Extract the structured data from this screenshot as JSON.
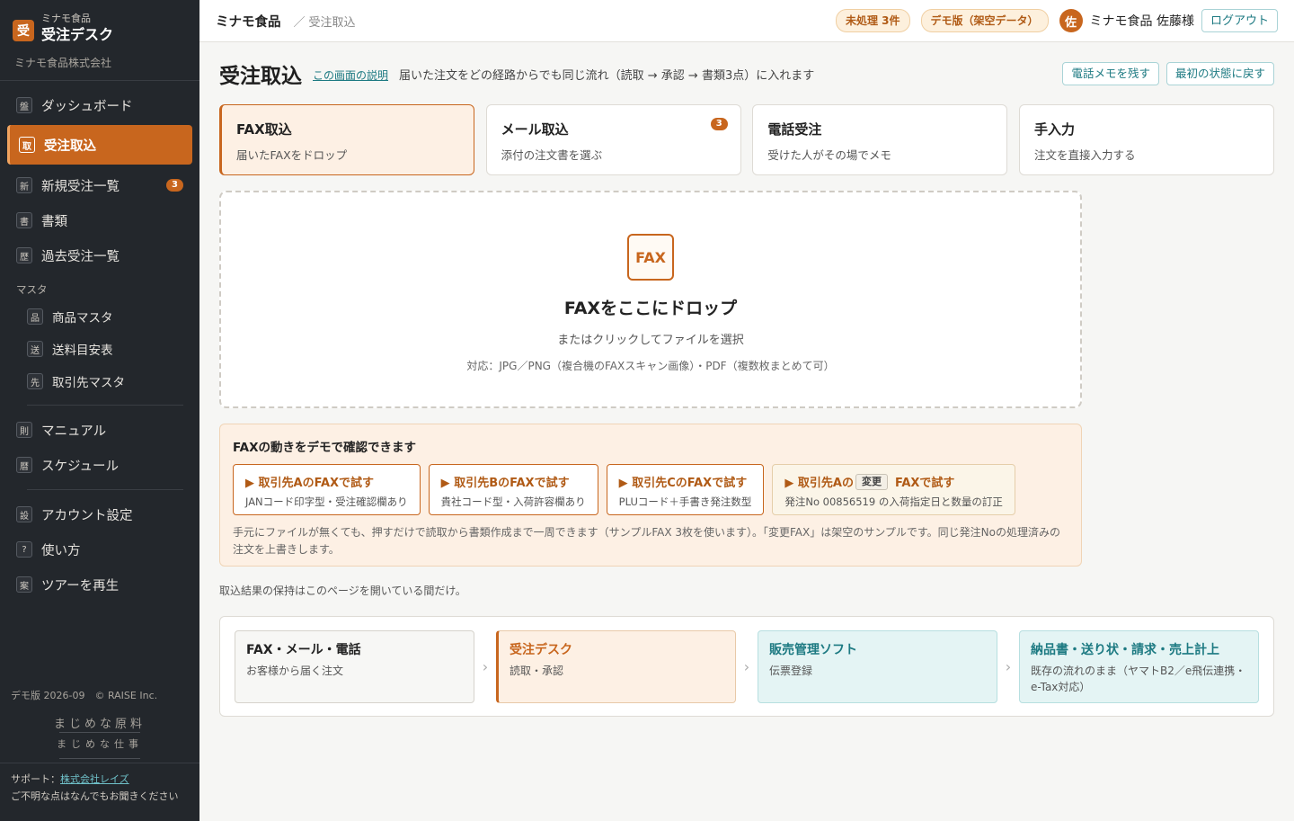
{
  "sidebar": {
    "logo_char": "受",
    "brand_small": "ミナモ食品",
    "brand_name": "受注デスク",
    "company": "ミナモ食品株式会社",
    "items": [
      {
        "icon": "盤",
        "label": "ダッシュボード"
      },
      {
        "icon": "取",
        "label": "受注取込"
      },
      {
        "icon": "新",
        "label": "新規受注一覧",
        "badge": "3"
      },
      {
        "icon": "書",
        "label": "書類"
      },
      {
        "icon": "歴",
        "label": "過去受注一覧"
      }
    ],
    "master_label": "マスタ",
    "master_items": [
      {
        "icon": "品",
        "label": "商品マスタ"
      },
      {
        "icon": "送",
        "label": "送料目安表"
      },
      {
        "icon": "先",
        "label": "取引先マスタ"
      }
    ],
    "items2": [
      {
        "icon": "則",
        "label": "マニュアル"
      },
      {
        "icon": "暦",
        "label": "スケジュール"
      }
    ],
    "items3": [
      {
        "icon": "設",
        "label": "アカウント設定"
      },
      {
        "icon": "?",
        "label": "使い方"
      },
      {
        "icon": "案",
        "label": "ツアーを再生"
      }
    ],
    "demo_line": "デモ版 2026-09　© RAISE Inc.",
    "motto1": "まじめな原料",
    "motto2": "まじめな仕事",
    "support_label": "サポート：",
    "support_link": "株式会社レイズ",
    "support_note": "ご不明な点はなんでもお聞きください"
  },
  "topbar": {
    "crumb_main": "ミナモ食品",
    "crumb_sep": "／",
    "crumb_sub": "受注取込",
    "pending_pill": "未処理 3件",
    "demo_pill": "デモ版（架空データ）",
    "avatar_char": "佐",
    "user_name": "ミナモ食品 佐藤様",
    "logout": "ログアウト"
  },
  "main": {
    "title": "受注取込",
    "help_link": "この画面の説明",
    "description": "届いた注文をどの経路からでも同じ流れ（読取 → 承認 → 書類3点）に入れます",
    "phone_memo_btn": "電話メモを残す",
    "reset_btn": "最初の状態に戻す",
    "tabs": [
      {
        "title": "FAX取込",
        "sub": "届いたFAXをドロップ"
      },
      {
        "title": "メール取込",
        "sub": "添付の注文書を選ぶ",
        "badge": "3"
      },
      {
        "title": "電話受注",
        "sub": "受けた人がその場でメモ"
      },
      {
        "title": "手入力",
        "sub": "注文を直接入力する"
      }
    ],
    "dropzone": {
      "icon_text": "FAX",
      "title": "FAXをここにドロップ",
      "sub": "またはクリックしてファイルを選択",
      "note": "対応：JPG／PNG（複合機のFAXスキャン画像）・PDF（複数枚まとめて可）"
    },
    "demo": {
      "title": "FAXの動きをデモで確認できます",
      "buttons": [
        {
          "title": "▶ 取引先AのFAXで試す",
          "sub": "JANコード印字型・受注確認欄あり"
        },
        {
          "title": "▶ 取引先BのFAXで試す",
          "sub": "貴社コード型・入荷許容欄あり"
        },
        {
          "title": "▶ 取引先CのFAXで試す",
          "sub": "PLUコード＋手書き発注数型"
        }
      ],
      "alt_button": {
        "title_pre": "▶ 取引先Aの",
        "tag": "変更",
        "title_post": "FAXで試す",
        "sub": "発注No 00856519 の入荷指定日と数量の訂正"
      },
      "note": "手元にファイルが無くても、押すだけで読取から書類作成まで一周できます（サンプルFAX 3枚を使います）。「変更FAX」は架空のサンプルです。同じ発注Noの処理済みの注文を上書きします。"
    },
    "retain_note": "取込結果の保持はこのページを開いている間だけ。",
    "flow": [
      {
        "title": "FAX・メール・電話",
        "sub": "お客様から届く注文"
      },
      {
        "title": "受注デスク",
        "sub": "読取・承認"
      },
      {
        "title": "販売管理ソフト",
        "sub": "伝票登録"
      },
      {
        "title": "納品書・送り状・請求・売上計上",
        "sub": "既存の流れのまま（ヤマトB2／e飛伝連携・e-Tax対応）"
      }
    ],
    "flow_arrow": "›"
  }
}
